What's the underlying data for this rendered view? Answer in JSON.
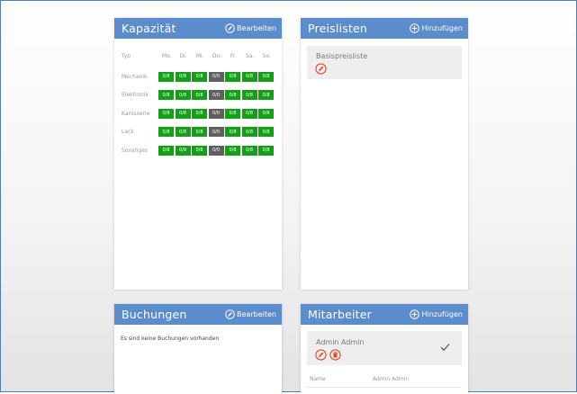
{
  "kapazitaet": {
    "title": "Kapazität",
    "edit_label": "Bearbeiten",
    "col_type": "Typ",
    "days": [
      "Mo.",
      "Di.",
      "Mi.",
      "Do.",
      "Fr.",
      "Sa.",
      "So."
    ],
    "rows": [
      {
        "label": "Mechanik",
        "cells": [
          "0/8",
          "0/8",
          "0/8",
          "0/0",
          "0/8",
          "0/8",
          "0/8"
        ]
      },
      {
        "label": "Elektronik",
        "cells": [
          "0/8",
          "0/8",
          "0/8",
          "0/0",
          "0/8",
          "0/8",
          "0/8"
        ]
      },
      {
        "label": "Karosserie",
        "cells": [
          "0/8",
          "0/8",
          "0/8",
          "0/0",
          "0/8",
          "0/8",
          "0/8"
        ]
      },
      {
        "label": "Lack",
        "cells": [
          "0/8",
          "0/8",
          "0/8",
          "0/0",
          "0/8",
          "0/8",
          "0/8"
        ]
      },
      {
        "label": "Sonstiges",
        "cells": [
          "0/8",
          "0/8",
          "0/8",
          "0/0",
          "0/8",
          "0/8",
          "0/8"
        ]
      }
    ],
    "colors": {
      "available": "#13a016",
      "closed": "#5f5f5f"
    }
  },
  "preislisten": {
    "title": "Preislisten",
    "add_label": "Hinzufügen",
    "items": [
      {
        "name": "Basispreisliste",
        "icon": "edit-icon"
      }
    ]
  },
  "buchungen": {
    "title": "Buchungen",
    "edit_label": "Bearbeiten",
    "empty_text": "Es sind keine Buchungen vorhanden"
  },
  "mitarbeiter": {
    "title": "Mitarbeiter",
    "add_label": "Hinzufügen",
    "employee": {
      "name": "Admin Admin",
      "icons": [
        "edit-icon",
        "delete-icon",
        "check-icon"
      ]
    },
    "details": {
      "label": "Name",
      "value": "Admin Admin"
    }
  },
  "theme": {
    "header": "#5b8ccc",
    "accent_red": "#e8482f",
    "frame": "#4f7fb7"
  }
}
